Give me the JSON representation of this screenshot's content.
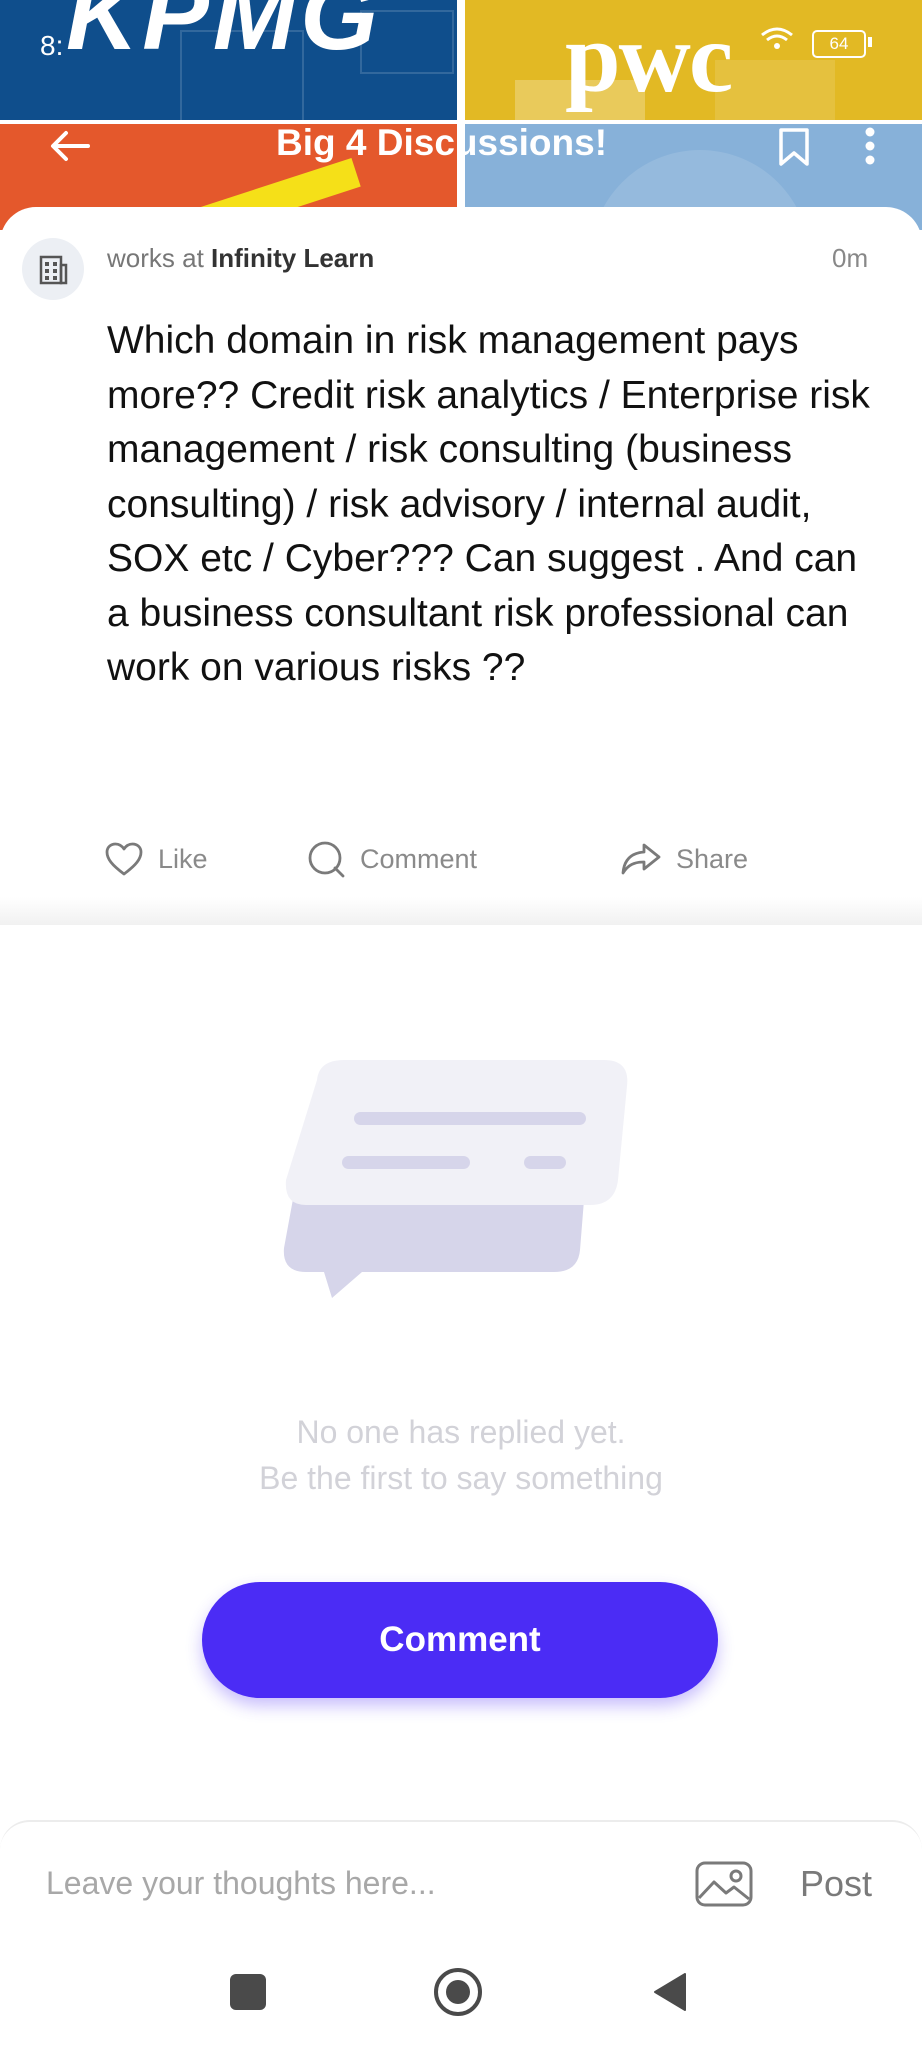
{
  "status_bar": {
    "time": "8:",
    "battery": "64"
  },
  "header": {
    "title": "Big 4 Discussions!",
    "logos": [
      "KPMG",
      "pwc"
    ],
    "tile_colors": [
      "#0f4e8c",
      "#e2b924",
      "#e4582c",
      "#87b1d9"
    ]
  },
  "post": {
    "author_prefix": "works at ",
    "company": "Infinity Learn",
    "time": "0m",
    "body": "Which domain in risk management pays more?? Credit risk analytics / Enterprise risk management / risk consulting (business consulting) / risk advisory / internal audit, SOX etc / Cyber??? Can suggest . And can a business consultant risk professional can work on various risks ??",
    "actions": {
      "like": "Like",
      "comment": "Comment",
      "share": "Share"
    }
  },
  "empty_state": {
    "line1": "No one has replied yet.",
    "line2": "Be the first to say something",
    "icon": "chat-bubble-illustration"
  },
  "cta": {
    "label": "Comment",
    "color": "#4b2cf5"
  },
  "composer": {
    "placeholder": "Leave your thoughts here...",
    "post_label": "Post"
  },
  "icons": [
    "back-arrow-icon",
    "bookmark-icon",
    "more-vert-icon",
    "building-icon",
    "heart-icon",
    "comment-icon",
    "share-icon",
    "image-icon",
    "nav-recents-icon",
    "nav-home-icon",
    "nav-back-icon"
  ]
}
